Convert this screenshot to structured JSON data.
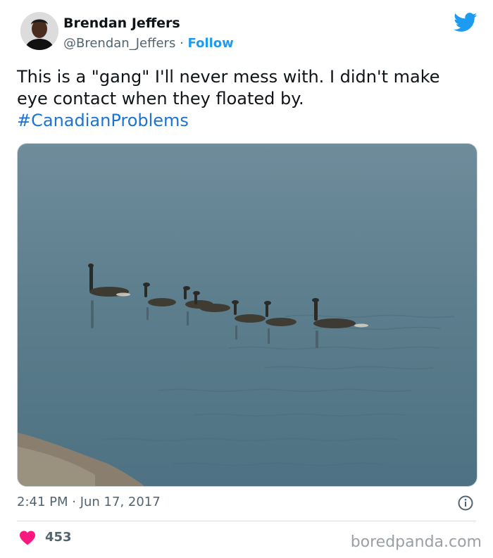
{
  "user": {
    "name": "Brendan Jeffers",
    "handle": "@Brendan_Jeffers",
    "separator": " · ",
    "follow_label": "Follow"
  },
  "tweet": {
    "line1": "This is a \"gang\" I'll never mess with. I didn't make",
    "line2": "eye contact when they floated by.",
    "hashtag": "#CanadianProblems"
  },
  "meta": {
    "timestamp": "2:41 PM · Jun 17, 2017",
    "like_count": "453"
  },
  "watermark": "boredpanda.com",
  "icons": {
    "brand": "twitter-bird-icon",
    "like": "heart-icon",
    "info": "info-icon"
  },
  "colors": {
    "accent": "#1d9bf0",
    "hashtag": "#1b74d4",
    "heart": "#f91880",
    "muted": "#536471",
    "water": "#5b7b8a"
  }
}
